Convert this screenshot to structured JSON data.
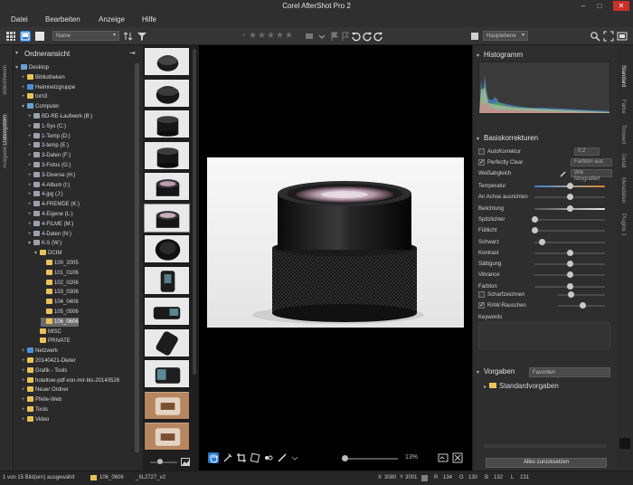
{
  "window": {
    "title": "Corel AfterShot Pro 2",
    "minimize": "–",
    "maximize": "□",
    "close": "✕"
  },
  "menu": [
    "Datei",
    "Bearbeiten",
    "Anzeige",
    "Hilfe"
  ],
  "toolbar": {
    "sort_select": "Name",
    "layer_select": "Hauptebene",
    "rating_stars": "★★★★★"
  },
  "left_tabs": [
    "Bibliotheken",
    "Dateisystem",
    "Ausgabe"
  ],
  "left_tabs_active": "Dateisystem",
  "folder_panel": {
    "title": "Ordneransicht"
  },
  "tree": [
    {
      "label": "Desktop",
      "level": 0,
      "icon": "desktop-icon",
      "twisty": "▾"
    },
    {
      "label": "Bibliotheken",
      "level": 1,
      "icon": "folder-icon",
      "twisty": "+"
    },
    {
      "label": "Heimnetzgruppe",
      "level": 1,
      "icon": "network-icon",
      "twisty": "+"
    },
    {
      "label": "tom3",
      "level": 1,
      "icon": "folder-icon",
      "twisty": "+"
    },
    {
      "label": "Computer",
      "level": 1,
      "icon": "computer-icon",
      "twisty": "▾"
    },
    {
      "label": "BD-RE-Laufwerk (B:)",
      "level": 2,
      "icon": "drive-icon",
      "twisty": "+"
    },
    {
      "label": "1-Sys (C:)",
      "level": 2,
      "icon": "drive-icon",
      "twisty": "+"
    },
    {
      "label": "1-Temp (D:)",
      "level": 2,
      "icon": "drive-icon",
      "twisty": "+"
    },
    {
      "label": "3-temp (E:)",
      "level": 2,
      "icon": "drive-icon",
      "twisty": "+"
    },
    {
      "label": "3-Daten (F:)",
      "level": 2,
      "icon": "drive-icon",
      "twisty": "+"
    },
    {
      "label": "3-Fotos (G:)",
      "level": 2,
      "icon": "drive-icon",
      "twisty": "+"
    },
    {
      "label": "3-Diverse (H:)",
      "level": 2,
      "icon": "drive-icon",
      "twisty": "+"
    },
    {
      "label": "4-Album (I:)",
      "level": 2,
      "icon": "drive-icon",
      "twisty": "+"
    },
    {
      "label": "4-jpg (J:)",
      "level": 2,
      "icon": "drive-icon",
      "twisty": "+"
    },
    {
      "label": "4-FREMDE (K:)",
      "level": 2,
      "icon": "drive-icon",
      "twisty": "+"
    },
    {
      "label": "4-Eigene (L:)",
      "level": 2,
      "icon": "drive-icon",
      "twisty": "+"
    },
    {
      "label": "4-FILME (M:)",
      "level": 2,
      "icon": "drive-icon",
      "twisty": "+"
    },
    {
      "label": "4-Daten (N:)",
      "level": 2,
      "icon": "drive-icon",
      "twisty": "+"
    },
    {
      "label": "K-5 (W:)",
      "level": 2,
      "icon": "drive-icon",
      "twisty": "▾"
    },
    {
      "label": "DCIM",
      "level": 3,
      "icon": "folder-icon",
      "twisty": "▾"
    },
    {
      "label": "100_2005",
      "level": 4,
      "icon": "folder-icon",
      "twisty": ""
    },
    {
      "label": "101_0106",
      "level": 4,
      "icon": "folder-icon",
      "twisty": ""
    },
    {
      "label": "102_0206",
      "level": 4,
      "icon": "folder-icon",
      "twisty": ""
    },
    {
      "label": "103_0306",
      "level": 4,
      "icon": "folder-icon",
      "twisty": ""
    },
    {
      "label": "104_0406",
      "level": 4,
      "icon": "folder-icon",
      "twisty": ""
    },
    {
      "label": "105_0506",
      "level": 4,
      "icon": "folder-icon",
      "twisty": ""
    },
    {
      "label": "106_0606",
      "level": 4,
      "icon": "folder-icon",
      "twisty": "",
      "selected": true
    },
    {
      "label": "MISC",
      "level": 3,
      "icon": "folder-icon",
      "twisty": ""
    },
    {
      "label": "PRIVATE",
      "level": 3,
      "icon": "folder-icon",
      "twisty": ""
    },
    {
      "label": "Netzwerk",
      "level": 1,
      "icon": "network-icon",
      "twisty": "+"
    },
    {
      "label": "20140421-Dieter",
      "level": 1,
      "icon": "folder-icon",
      "twisty": "+"
    },
    {
      "label": "Grafik - Tools",
      "level": 1,
      "icon": "folder-icon",
      "twisty": "+"
    },
    {
      "label": "hoteltow-pdf-von-mir-bis-20140526",
      "level": 1,
      "icon": "folder-icon",
      "twisty": "+"
    },
    {
      "label": "Neuer Ordner",
      "level": 1,
      "icon": "folder-icon",
      "twisty": "+"
    },
    {
      "label": "Pfeile-Web",
      "level": 1,
      "icon": "folder-icon",
      "twisty": "+"
    },
    {
      "label": "Tools",
      "level": 1,
      "icon": "folder-icon",
      "twisty": "+"
    },
    {
      "label": "Video",
      "level": 1,
      "icon": "folder-icon",
      "twisty": "+"
    }
  ],
  "thumbnails": [
    {
      "kind": "lens-cap-small"
    },
    {
      "kind": "lens-cap"
    },
    {
      "kind": "lens-ring"
    },
    {
      "kind": "lens-ring"
    },
    {
      "kind": "lens-front"
    },
    {
      "kind": "lens-front-selected",
      "selected": true
    },
    {
      "kind": "lens-hood"
    },
    {
      "kind": "scope-side"
    },
    {
      "kind": "scope-angle"
    },
    {
      "kind": "scope-top"
    },
    {
      "kind": "scope-body"
    },
    {
      "kind": "strap"
    },
    {
      "kind": "strap"
    }
  ],
  "viewer": {
    "zoom": "13%"
  },
  "right_tabs": [
    "Standard",
    "Farbe",
    "Tonwert",
    "Detail",
    "Metadaten",
    "Plugins 1"
  ],
  "right_tabs_active": "Standard",
  "histogram": {
    "title": "Histogramm"
  },
  "basic": {
    "title": "Basiskorrekturen",
    "auto_label": "AutoKorrektur",
    "auto_value": "0,2",
    "perfectly_clear_label": "Perfectly Clear",
    "perfectly_clear_value": "Farbton aus",
    "wb_label": "Weißabgleich",
    "wb_value": "Wie fotografiert",
    "sliders": [
      {
        "label": "Temperatur",
        "pos": 0.5
      },
      {
        "label": "An Achse ausrichten",
        "pos": 0.5
      },
      {
        "label": "Belichtung",
        "pos": 0.5
      },
      {
        "label": "Spitzlichter",
        "pos": 0.0
      },
      {
        "label": "Fülllicht",
        "pos": 0.0
      },
      {
        "label": "Schwarz",
        "pos": 0.1
      },
      {
        "label": "Kontrast",
        "pos": 0.5
      },
      {
        "label": "Sättigung",
        "pos": 0.5
      },
      {
        "label": "Vibrance",
        "pos": 0.5
      },
      {
        "label": "Farbton",
        "pos": 0.5
      }
    ],
    "sharpen_label": "Scharfzeichnen",
    "raw_noise_label": "RAW-Rauschen",
    "keywords_label": "Keywords"
  },
  "presets": {
    "title": "Vorgaben",
    "filter_select": "Favoriten",
    "default_folder": "Standardvorgaben"
  },
  "reset_button": "Alles zurücksetzen",
  "status": {
    "selection": "1 von 15 Bild(ern) ausgewählt",
    "folder": "106_0606",
    "file": "_IIL2727_v2",
    "x_label": "X",
    "x_value": "3080",
    "y_label": "Y",
    "y_value": "3001",
    "r_label": "R",
    "r_value": "134",
    "g_label": "G",
    "g_value": "130",
    "b_label": "B",
    "b_value": "132",
    "l_label": "L",
    "l_value": "131"
  },
  "colors": {
    "accent": "#2a7bd1",
    "folder": "#e8c35a",
    "close_button": "#c9302c"
  }
}
